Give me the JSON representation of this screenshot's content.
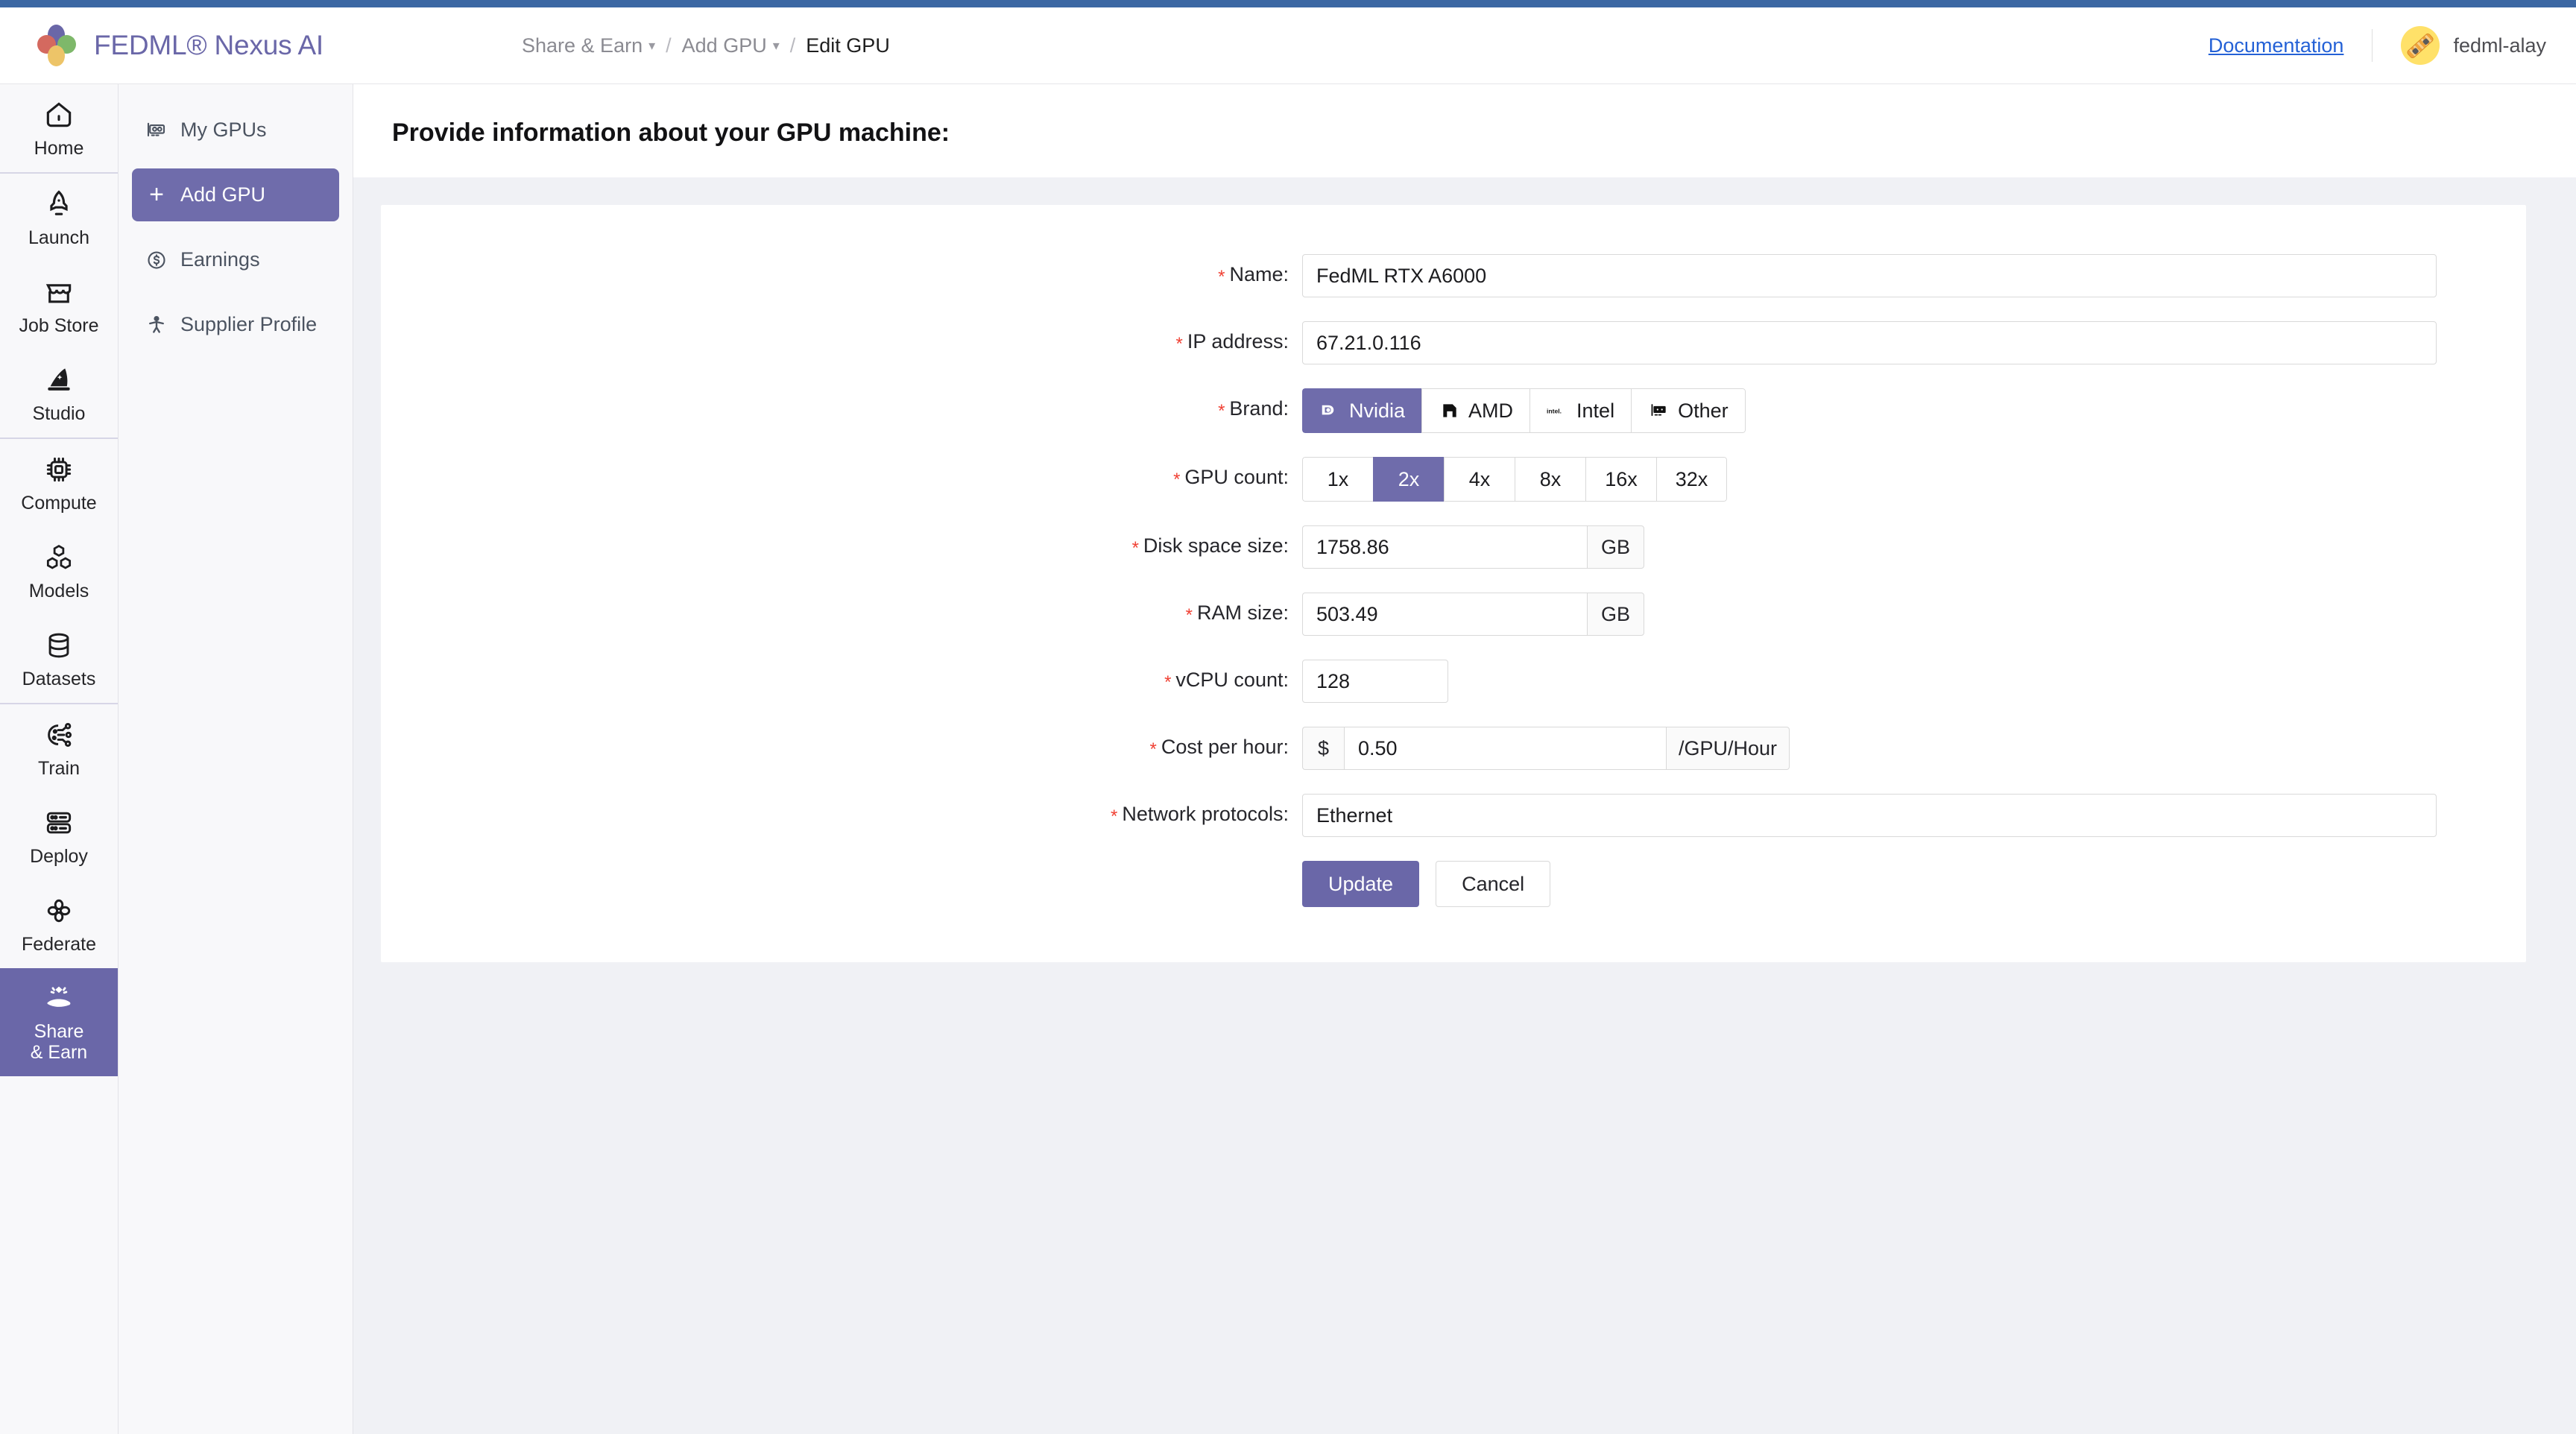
{
  "colors": {
    "accent_purple": "#6a67a8",
    "accent_purple_light": "#6f6cab",
    "link_blue": "#2461d6",
    "top_strip_blue": "#3c67a3",
    "page_bg": "#f0f1f5",
    "required_red": "#f04134",
    "avatar_yellow": "#ffe169"
  },
  "header": {
    "brand_title": "FEDML® Nexus AI",
    "logo_icon": "flower-logo-icon",
    "breadcrumb": [
      {
        "label": "Share & Earn",
        "icon": "chevron-down-icon",
        "has_chevron": true,
        "current": false
      },
      {
        "label": "Add GPU",
        "icon": "chevron-down-icon",
        "has_chevron": true,
        "current": false
      },
      {
        "label": "Edit GPU",
        "has_chevron": false,
        "current": true
      }
    ],
    "breadcrumb_separator": "/",
    "documentation_label": "Documentation",
    "avatar_icon": "skateboard-avatar-icon",
    "username": "fedml-alay"
  },
  "rail": {
    "items": [
      {
        "label": "Home",
        "icon": "home-icon",
        "active": false,
        "sep_after": true
      },
      {
        "label": "Launch",
        "icon": "rocket-icon",
        "active": false,
        "sep_after": false
      },
      {
        "label": "Job Store",
        "icon": "storefront-icon",
        "active": false,
        "sep_after": false
      },
      {
        "label": "Studio",
        "icon": "wizard-hat-icon",
        "active": false,
        "sep_after": true
      },
      {
        "label": "Compute",
        "icon": "chip-icon",
        "active": false,
        "sep_after": false
      },
      {
        "label": "Models",
        "icon": "cubes-icon",
        "active": false,
        "sep_after": false
      },
      {
        "label": "Datasets",
        "icon": "database-icon",
        "active": false,
        "sep_after": true
      },
      {
        "label": "Train",
        "icon": "brain-network-icon",
        "active": false,
        "sep_after": false
      },
      {
        "label": "Deploy",
        "icon": "server-icon",
        "active": false,
        "sep_after": false
      },
      {
        "label": "Federate",
        "icon": "federate-flower-icon",
        "active": false,
        "sep_after": false
      },
      {
        "label": "Share\n& Earn",
        "label_line1": "Share",
        "label_line2": "& Earn",
        "icon": "hand-gem-icon",
        "active": true,
        "sep_after": false
      }
    ]
  },
  "sidebar": {
    "items": [
      {
        "label": "My GPUs",
        "icon": "gpu-card-icon",
        "active": false
      },
      {
        "label": "Add GPU",
        "icon": "plus-icon",
        "active": true
      },
      {
        "label": "Earnings",
        "icon": "dollar-circle-icon",
        "active": false
      },
      {
        "label": "Supplier Profile",
        "icon": "person-icon",
        "active": false
      }
    ]
  },
  "main": {
    "page_title": "Provide information about your GPU machine:",
    "form": {
      "name": {
        "label": "Name",
        "required": true,
        "value": "FedML RTX A6000"
      },
      "ip_address": {
        "label": "IP address",
        "required": true,
        "value": "67.21.0.116"
      },
      "brand": {
        "label": "Brand",
        "required": true,
        "selected": "Nvidia",
        "options": [
          {
            "label": "Nvidia",
            "icon": "nvidia-logo-icon",
            "selected": true
          },
          {
            "label": "AMD",
            "icon": "amd-logo-icon",
            "selected": false
          },
          {
            "label": "Intel",
            "icon": "intel-logo-icon",
            "selected": false
          },
          {
            "label": "Other",
            "icon": "gpu-card-icon",
            "selected": false
          }
        ]
      },
      "gpu_count": {
        "label": "GPU count",
        "required": true,
        "selected": "2x",
        "options": [
          "1x",
          "2x",
          "4x",
          "8x",
          "16x",
          "32x"
        ]
      },
      "disk_space": {
        "label": "Disk space size",
        "required": true,
        "value": "1758.86",
        "unit": "GB"
      },
      "ram_size": {
        "label": "RAM size",
        "required": true,
        "value": "503.49",
        "unit": "GB"
      },
      "vcpu_count": {
        "label": "vCPU count",
        "required": true,
        "value": "128"
      },
      "cost_per_hour": {
        "label": "Cost per hour",
        "required": true,
        "currency": "$",
        "value": "0.50",
        "unit": "/GPU/Hour"
      },
      "network_protocols": {
        "label": "Network protocols",
        "required": true,
        "value": "Ethernet"
      }
    },
    "actions": {
      "update_label": "Update",
      "cancel_label": "Cancel"
    }
  }
}
